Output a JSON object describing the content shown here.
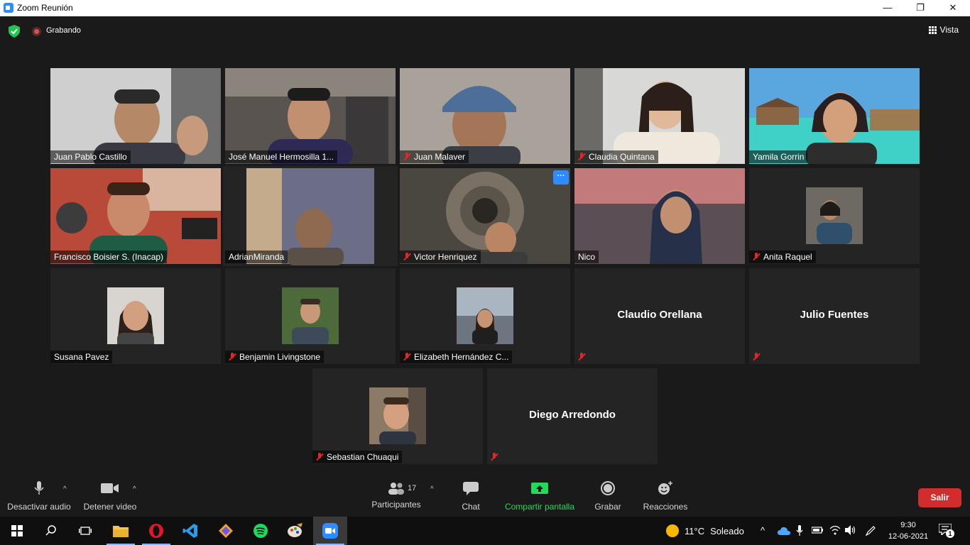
{
  "window": {
    "title": "Zoom Reunión",
    "minimize": "—",
    "maximize": "❐",
    "close": "✕"
  },
  "topbar": {
    "recording_label": "Grabando",
    "view_label": "Vista"
  },
  "participants": [
    {
      "name": "Juan Pablo Castillo",
      "muted": false,
      "video": true
    },
    {
      "name": "José Manuel Hermosilla 1...",
      "muted": false,
      "video": true
    },
    {
      "name": "Juan Malaver",
      "muted": true,
      "video": true
    },
    {
      "name": "Claudia Quintana",
      "muted": true,
      "video": true
    },
    {
      "name": "Yamila Gorrin",
      "muted": false,
      "video": true
    },
    {
      "name": "Francisco Boisier S. (Inacap)",
      "muted": false,
      "video": true
    },
    {
      "name": "AdrianMiranda",
      "muted": false,
      "video": true,
      "active_speaker": true
    },
    {
      "name": "Victor Henriquez",
      "muted": true,
      "video": true,
      "more_label": "···"
    },
    {
      "name": "Nico",
      "muted": false,
      "video": true
    },
    {
      "name": "Anita Raquel",
      "muted": true,
      "video": false
    },
    {
      "name": "Susana Pavez",
      "muted": false,
      "video": false
    },
    {
      "name": "Benjamin Livingstone",
      "muted": true,
      "video": false
    },
    {
      "name": "Elizabeth Hernández C...",
      "muted": true,
      "video": false
    },
    {
      "name": "Claudio Orellana",
      "muted": true,
      "video": false,
      "no_picture": true
    },
    {
      "name": "Julio Fuentes",
      "muted": true,
      "video": false,
      "no_picture": true
    },
    {
      "name": "Sebastian Chuaqui",
      "muted": true,
      "video": false
    },
    {
      "name": "Diego Arredondo",
      "muted": true,
      "video": false,
      "no_picture": true
    }
  ],
  "toolbar": {
    "mute_label": "Desactivar audio",
    "video_label": "Detener video",
    "participants_label": "Participantes",
    "participants_count": "17",
    "chat_label": "Chat",
    "share_label": "Compartir pantalla",
    "record_label": "Grabar",
    "reactions_label": "Reacciones",
    "leave_label": "Salir",
    "share_color": "#23d959"
  },
  "taskbar": {
    "temperature": "11°C",
    "weather": "Soleado",
    "time": "9:30",
    "date": "12-06-2021",
    "notifications": "1"
  }
}
